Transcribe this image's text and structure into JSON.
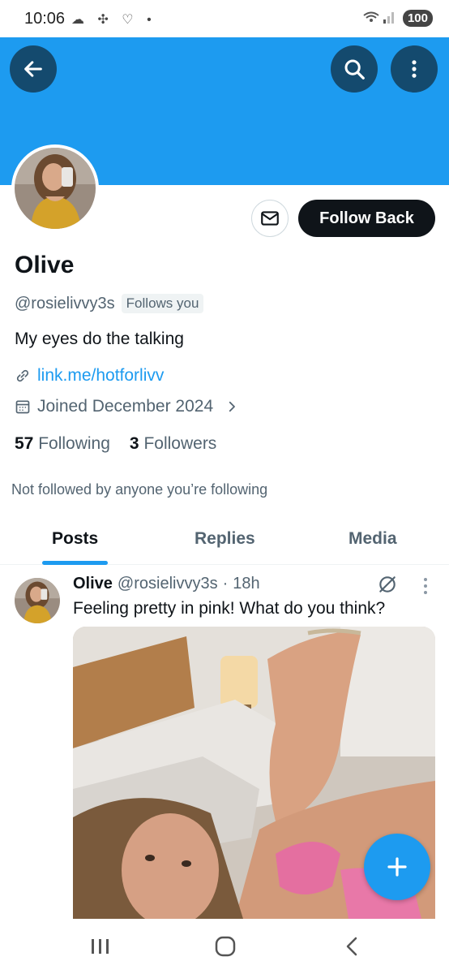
{
  "status_bar": {
    "time": "10:06",
    "left_icons": [
      "cloud-icon",
      "pinwheel-icon",
      "heart-icon",
      "dot-icon"
    ],
    "battery": "100"
  },
  "header": {
    "banner_color": "#1d9bf0",
    "back_icon": "arrow-left-icon",
    "search_icon": "search-icon",
    "more_icon": "more-vertical-icon"
  },
  "profile": {
    "display_name": "Olive",
    "handle": "@rosielivvy3s",
    "follows_you": "Follows you",
    "bio": "My eyes do the talking",
    "link": "link.me/hotforlivv",
    "joined": "Joined December 2024",
    "following_count": "57",
    "following_label": "Following",
    "followers_count": "3",
    "followers_label": "Followers",
    "not_followed_text": "Not followed by anyone you’re following",
    "follow_button": "Follow Back"
  },
  "tabs": [
    {
      "label": "Posts",
      "active": true
    },
    {
      "label": "Replies",
      "active": false
    },
    {
      "label": "Media",
      "active": false
    }
  ],
  "post": {
    "name": "Olive",
    "handle": "@rosielivvy3s",
    "separator": "·",
    "time": "18h",
    "text": "Feeling pretty in pink! What do you think?"
  },
  "colors": {
    "accent": "#1d9bf0",
    "header_button": "#144a6e",
    "text_primary": "#0f1419",
    "text_secondary": "#536471"
  }
}
